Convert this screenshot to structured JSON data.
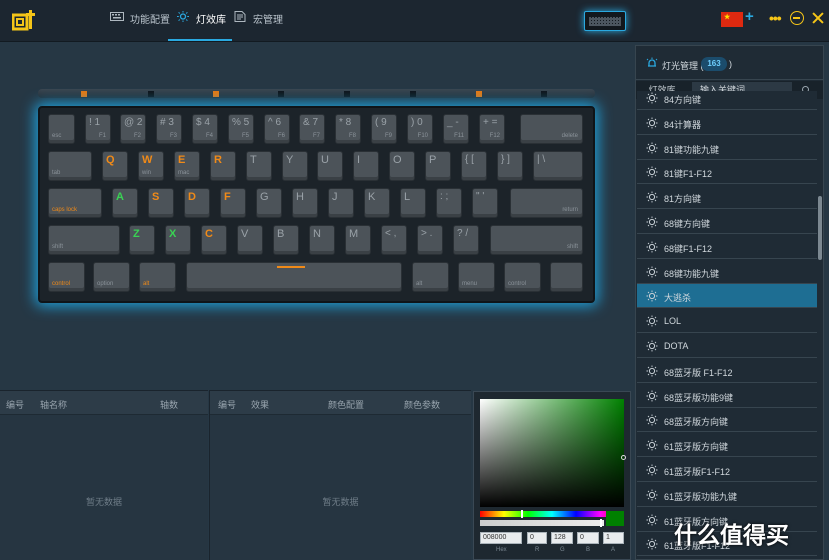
{
  "nav": {
    "items": [
      {
        "label": "功能配置",
        "icon": "keyboard-icon"
      },
      {
        "label": "灯效库",
        "icon": "sun-icon"
      },
      {
        "label": "宏管理",
        "icon": "document-icon"
      }
    ],
    "active": 1
  },
  "colors": {
    "accent": "#2aa9e0",
    "window_controls": "#f5c518",
    "lit_orange": "#f08a18",
    "lit_green": "#39d353",
    "selected_row": "#1e6e93"
  },
  "keyboard": {
    "row0": [
      {
        "main": "",
        "sub": "esc"
      },
      {
        "main": "! 1",
        "sub": "F1"
      },
      {
        "main": "@ 2",
        "sub": "F2"
      },
      {
        "main": "# 3",
        "sub": "F3"
      },
      {
        "main": "$ 4",
        "sub": "F4"
      },
      {
        "main": "% 5",
        "sub": "F5"
      },
      {
        "main": "^ 6",
        "sub": "F6"
      },
      {
        "main": "& 7",
        "sub": "F7"
      },
      {
        "main": "* 8",
        "sub": "F8"
      },
      {
        "main": "( 9",
        "sub": "F9"
      },
      {
        "main": ") 0",
        "sub": "F10"
      },
      {
        "main": "_ -",
        "sub": "F11"
      },
      {
        "main": "+ =",
        "sub": "F12"
      },
      {
        "main": "",
        "sub": "delete"
      }
    ],
    "row1": [
      "",
      "Q",
      "W",
      "E",
      "R",
      "T",
      "Y",
      "U",
      "I",
      "O",
      "P",
      "{ [",
      "} ]",
      "| \\"
    ],
    "row1_sub": [
      "tab",
      "",
      "win",
      "mac",
      "",
      "",
      "",
      "",
      "",
      "",
      "",
      "",
      "",
      ""
    ],
    "row2": [
      "",
      "A",
      "S",
      "D",
      "F",
      "G",
      "H",
      "J",
      "K",
      "L",
      ": ;",
      "\" '",
      ""
    ],
    "row2_sub": [
      "caps lock",
      "",
      "",
      "",
      "",
      "",
      "",
      "",
      "",
      "",
      "",
      "",
      "return"
    ],
    "row3": [
      "",
      "Z",
      "X",
      "C",
      "V",
      "B",
      "N",
      "M",
      "< ,",
      "> .",
      "? /",
      ""
    ],
    "row3_sub": [
      "shift",
      "",
      "",
      "",
      "",
      "",
      "",
      "",
      "",
      "",
      "",
      "shift"
    ],
    "row4_sub": [
      "control",
      "option",
      "alt",
      "",
      "alt",
      "menu",
      "control",
      ""
    ]
  },
  "effects_table": {
    "headers": [
      "编号",
      "轴名称",
      "轴数"
    ],
    "empty": "暂无数据"
  },
  "lights_table": {
    "headers": [
      "编号",
      "效果",
      "颜色配置",
      "颜色参数"
    ],
    "empty": "暂无数据"
  },
  "picker": {
    "hex": "008000",
    "r": "0",
    "g": "128",
    "b": "0",
    "a": "1",
    "hex_label": "Hex",
    "r_label": "R",
    "g_label": "G",
    "b_label": "B",
    "a_label": "A"
  },
  "light_manager": {
    "title": "灯光管理 (",
    "count": "163",
    "close_paren": ")",
    "tab": "灯效库",
    "search_placeholder": "输入关键词",
    "items": [
      "84方向键",
      "84计算器",
      "81键功能九键",
      "81键F1-F12",
      "81方向键",
      "68键方向键",
      "68键F1-F12",
      "68键功能九键",
      "大逃杀",
      "LOL",
      "DOTA",
      "68蓝牙版 F1-F12",
      "68蓝牙版功能9键",
      "68蓝牙版方向键",
      "61蓝牙版方向键",
      "61蓝牙版F1-F12",
      "61蓝牙版功能九键",
      "61蓝牙版方向键",
      "61蓝牙版F1-F12"
    ],
    "selected": 8
  },
  "watermark": {
    "text": "什么值得买"
  }
}
